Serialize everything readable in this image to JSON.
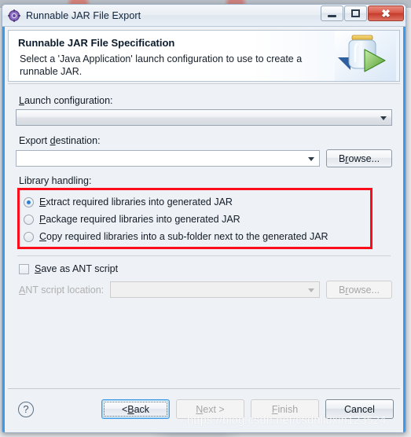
{
  "window": {
    "title": "Runnable JAR File Export",
    "icon": "gear-icon",
    "controls": {
      "minimize": "—",
      "maximize": "□",
      "close": "✖"
    }
  },
  "header": {
    "title": "Runnable JAR File Specification",
    "description": "Select a 'Java Application' launch configuration to use to create a runnable JAR.",
    "icon": "jar-with-play-arrow-icon"
  },
  "form": {
    "launch_configuration": {
      "label_pre": "",
      "label_mnemonic": "L",
      "label_post": "aunch configuration:",
      "value": "",
      "placeholder": ""
    },
    "export_destination": {
      "label_pre": "Export ",
      "label_mnemonic": "d",
      "label_post": "estination:",
      "value": "",
      "placeholder": "",
      "browse_pre": "B",
      "browse_mnemonic": "r",
      "browse_post": "owse..."
    },
    "library_handling": {
      "label": "Library handling:",
      "selected_index": 0,
      "options": [
        {
          "mnemonic": "E",
          "text": "xtract required libraries into generated JAR"
        },
        {
          "mnemonic": "P",
          "text": "ackage required libraries into generated JAR"
        },
        {
          "mnemonic": "C",
          "text": "opy required libraries into a sub-folder next to the generated JAR"
        }
      ],
      "highlight_color": "#fc0d1b"
    },
    "save_as_ant": {
      "mnemonic": "S",
      "text": "ave as ANT script",
      "checked": false
    },
    "ant_script_location": {
      "label_mnemonic": "A",
      "label_post": "NT script location:",
      "value": "",
      "enabled": false,
      "browse_pre": "B",
      "browse_mnemonic": "r",
      "browse_post": "owse..."
    }
  },
  "footer": {
    "help_icon": "question-mark-icon",
    "buttons": [
      {
        "pre": "< ",
        "mnemonic": "B",
        "post": "ack",
        "state": "focused"
      },
      {
        "pre": "",
        "mnemonic": "N",
        "post": "ext >",
        "state": "disabled"
      },
      {
        "pre": "",
        "mnemonic": "F",
        "post": "inish",
        "state": "disabled"
      },
      {
        "pre": "Cancel",
        "mnemonic": "",
        "post": "",
        "state": "enabled"
      }
    ]
  },
  "watermark": "https://blog.csdn.net/csdnliuxin123524"
}
